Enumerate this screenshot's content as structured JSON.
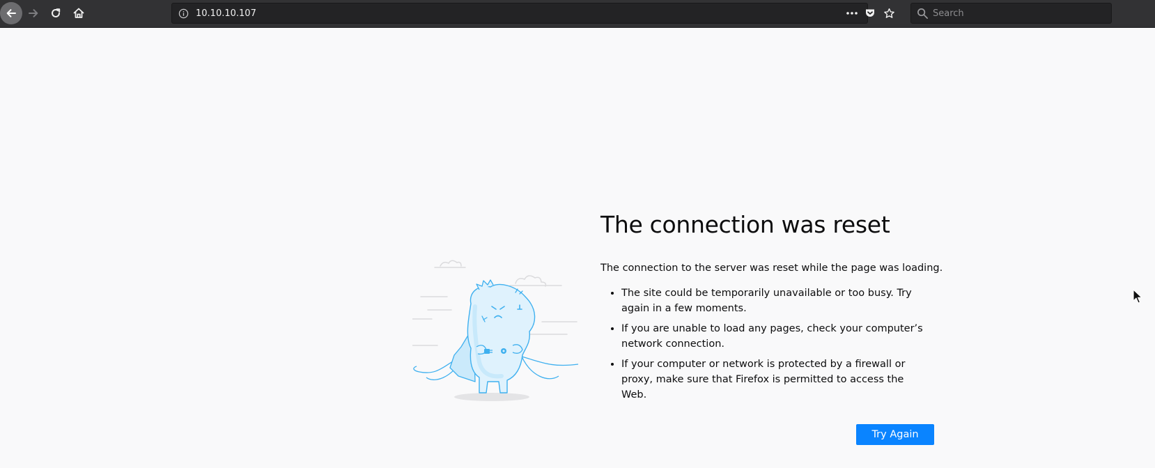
{
  "browser": {
    "url": "10.10.10.107",
    "search_placeholder": "Search",
    "icons": {
      "back": "back-arrow-icon",
      "forward": "forward-arrow-icon",
      "reload": "reload-icon",
      "home": "home-icon",
      "info": "info-icon",
      "more": "more-actions-icon",
      "pocket": "pocket-icon",
      "bookmark": "star-icon",
      "search": "search-icon"
    }
  },
  "error": {
    "title": "The connection was reset",
    "description": "The connection to the server was reset while the page was loading.",
    "reasons": [
      "The site could be temporarily unavailable or too busy. Try again in a few moments.",
      "If you are unable to load any pages, check your computer’s network connection.",
      "If your computer or network is protected by a firewall or proxy, make sure that Firefox is permitted to access the Web."
    ],
    "button_label": "Try Again"
  },
  "colors": {
    "accent": "#0a84ff",
    "toolbar": "#323234",
    "page_bg": "#f9f9fa",
    "illustration": "#3fb0ef"
  }
}
